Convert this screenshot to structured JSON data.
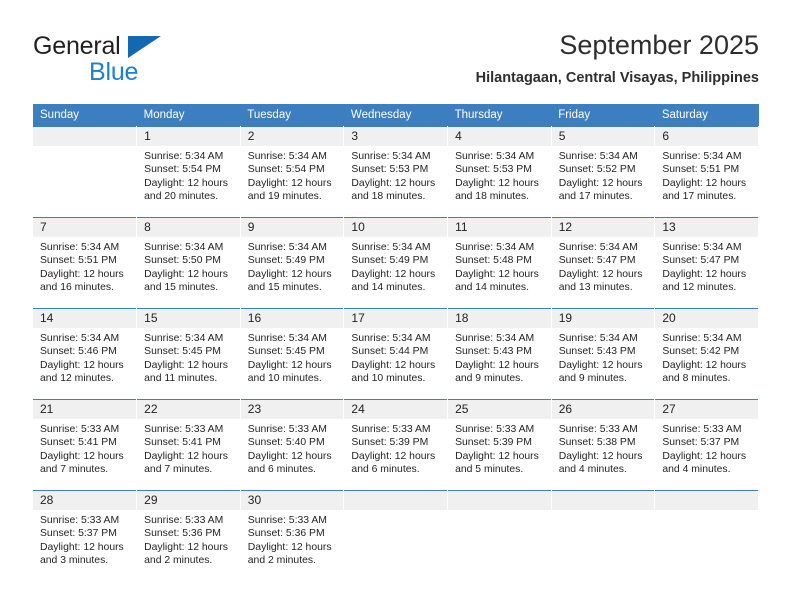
{
  "logo": {
    "primary_text": "General",
    "secondary_text": "Blue",
    "primary_color": "#231f20",
    "secondary_color": "#1b7fd4",
    "triangle_color": "#1268b3"
  },
  "header": {
    "title": "September 2025",
    "subtitle": "Hilantagaan, Central Visayas, Philippines"
  },
  "theme": {
    "header_bg": "#3c7ebf",
    "header_text": "#ffffff",
    "daynum_bg": "#f0f0f0",
    "body_text": "#231f20",
    "page_bg": "#ffffff"
  },
  "calendar": {
    "weekday_headers": [
      "Sunday",
      "Monday",
      "Tuesday",
      "Wednesday",
      "Thursday",
      "Friday",
      "Saturday"
    ],
    "weeks": [
      [
        {
          "day": "",
          "sunrise": "",
          "sunset": "",
          "daylight": ""
        },
        {
          "day": "1",
          "sunrise": "Sunrise: 5:34 AM",
          "sunset": "Sunset: 5:54 PM",
          "daylight": "Daylight: 12 hours and 20 minutes."
        },
        {
          "day": "2",
          "sunrise": "Sunrise: 5:34 AM",
          "sunset": "Sunset: 5:54 PM",
          "daylight": "Daylight: 12 hours and 19 minutes."
        },
        {
          "day": "3",
          "sunrise": "Sunrise: 5:34 AM",
          "sunset": "Sunset: 5:53 PM",
          "daylight": "Daylight: 12 hours and 18 minutes."
        },
        {
          "day": "4",
          "sunrise": "Sunrise: 5:34 AM",
          "sunset": "Sunset: 5:53 PM",
          "daylight": "Daylight: 12 hours and 18 minutes."
        },
        {
          "day": "5",
          "sunrise": "Sunrise: 5:34 AM",
          "sunset": "Sunset: 5:52 PM",
          "daylight": "Daylight: 12 hours and 17 minutes."
        },
        {
          "day": "6",
          "sunrise": "Sunrise: 5:34 AM",
          "sunset": "Sunset: 5:51 PM",
          "daylight": "Daylight: 12 hours and 17 minutes."
        }
      ],
      [
        {
          "day": "7",
          "sunrise": "Sunrise: 5:34 AM",
          "sunset": "Sunset: 5:51 PM",
          "daylight": "Daylight: 12 hours and 16 minutes."
        },
        {
          "day": "8",
          "sunrise": "Sunrise: 5:34 AM",
          "sunset": "Sunset: 5:50 PM",
          "daylight": "Daylight: 12 hours and 15 minutes."
        },
        {
          "day": "9",
          "sunrise": "Sunrise: 5:34 AM",
          "sunset": "Sunset: 5:49 PM",
          "daylight": "Daylight: 12 hours and 15 minutes."
        },
        {
          "day": "10",
          "sunrise": "Sunrise: 5:34 AM",
          "sunset": "Sunset: 5:49 PM",
          "daylight": "Daylight: 12 hours and 14 minutes."
        },
        {
          "day": "11",
          "sunrise": "Sunrise: 5:34 AM",
          "sunset": "Sunset: 5:48 PM",
          "daylight": "Daylight: 12 hours and 14 minutes."
        },
        {
          "day": "12",
          "sunrise": "Sunrise: 5:34 AM",
          "sunset": "Sunset: 5:47 PM",
          "daylight": "Daylight: 12 hours and 13 minutes."
        },
        {
          "day": "13",
          "sunrise": "Sunrise: 5:34 AM",
          "sunset": "Sunset: 5:47 PM",
          "daylight": "Daylight: 12 hours and 12 minutes."
        }
      ],
      [
        {
          "day": "14",
          "sunrise": "Sunrise: 5:34 AM",
          "sunset": "Sunset: 5:46 PM",
          "daylight": "Daylight: 12 hours and 12 minutes."
        },
        {
          "day": "15",
          "sunrise": "Sunrise: 5:34 AM",
          "sunset": "Sunset: 5:45 PM",
          "daylight": "Daylight: 12 hours and 11 minutes."
        },
        {
          "day": "16",
          "sunrise": "Sunrise: 5:34 AM",
          "sunset": "Sunset: 5:45 PM",
          "daylight": "Daylight: 12 hours and 10 minutes."
        },
        {
          "day": "17",
          "sunrise": "Sunrise: 5:34 AM",
          "sunset": "Sunset: 5:44 PM",
          "daylight": "Daylight: 12 hours and 10 minutes."
        },
        {
          "day": "18",
          "sunrise": "Sunrise: 5:34 AM",
          "sunset": "Sunset: 5:43 PM",
          "daylight": "Daylight: 12 hours and 9 minutes."
        },
        {
          "day": "19",
          "sunrise": "Sunrise: 5:34 AM",
          "sunset": "Sunset: 5:43 PM",
          "daylight": "Daylight: 12 hours and 9 minutes."
        },
        {
          "day": "20",
          "sunrise": "Sunrise: 5:34 AM",
          "sunset": "Sunset: 5:42 PM",
          "daylight": "Daylight: 12 hours and 8 minutes."
        }
      ],
      [
        {
          "day": "21",
          "sunrise": "Sunrise: 5:33 AM",
          "sunset": "Sunset: 5:41 PM",
          "daylight": "Daylight: 12 hours and 7 minutes."
        },
        {
          "day": "22",
          "sunrise": "Sunrise: 5:33 AM",
          "sunset": "Sunset: 5:41 PM",
          "daylight": "Daylight: 12 hours and 7 minutes."
        },
        {
          "day": "23",
          "sunrise": "Sunrise: 5:33 AM",
          "sunset": "Sunset: 5:40 PM",
          "daylight": "Daylight: 12 hours and 6 minutes."
        },
        {
          "day": "24",
          "sunrise": "Sunrise: 5:33 AM",
          "sunset": "Sunset: 5:39 PM",
          "daylight": "Daylight: 12 hours and 6 minutes."
        },
        {
          "day": "25",
          "sunrise": "Sunrise: 5:33 AM",
          "sunset": "Sunset: 5:39 PM",
          "daylight": "Daylight: 12 hours and 5 minutes."
        },
        {
          "day": "26",
          "sunrise": "Sunrise: 5:33 AM",
          "sunset": "Sunset: 5:38 PM",
          "daylight": "Daylight: 12 hours and 4 minutes."
        },
        {
          "day": "27",
          "sunrise": "Sunrise: 5:33 AM",
          "sunset": "Sunset: 5:37 PM",
          "daylight": "Daylight: 12 hours and 4 minutes."
        }
      ],
      [
        {
          "day": "28",
          "sunrise": "Sunrise: 5:33 AM",
          "sunset": "Sunset: 5:37 PM",
          "daylight": "Daylight: 12 hours and 3 minutes."
        },
        {
          "day": "29",
          "sunrise": "Sunrise: 5:33 AM",
          "sunset": "Sunset: 5:36 PM",
          "daylight": "Daylight: 12 hours and 2 minutes."
        },
        {
          "day": "30",
          "sunrise": "Sunrise: 5:33 AM",
          "sunset": "Sunset: 5:36 PM",
          "daylight": "Daylight: 12 hours and 2 minutes."
        },
        {
          "day": "",
          "sunrise": "",
          "sunset": "",
          "daylight": ""
        },
        {
          "day": "",
          "sunrise": "",
          "sunset": "",
          "daylight": ""
        },
        {
          "day": "",
          "sunrise": "",
          "sunset": "",
          "daylight": ""
        },
        {
          "day": "",
          "sunrise": "",
          "sunset": "",
          "daylight": ""
        }
      ]
    ]
  }
}
